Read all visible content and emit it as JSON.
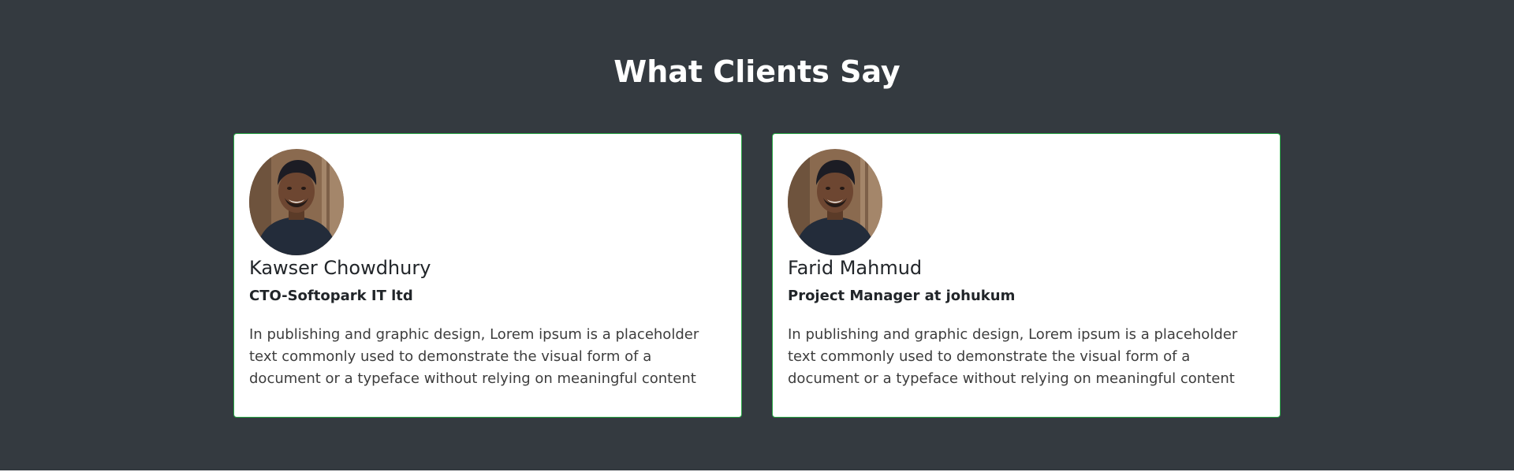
{
  "section": {
    "title": "What Clients Say"
  },
  "testimonials": [
    {
      "name": "Kawser Chowdhury",
      "role": "CTO-Softopark IT ltd",
      "quote": "In publishing and graphic design, Lorem ipsum is a placeholder text commonly used to demonstrate the visual form of a document or a typeface without relying on meaningful content",
      "avatar": "client-photo"
    },
    {
      "name": "Farid Mahmud",
      "role": "Project Manager at johukum",
      "quote": "In publishing and graphic design, Lorem ipsum is a placeholder text commonly used to demonstrate the visual form of a document or a typeface without relying on meaningful content",
      "avatar": "client-photo"
    }
  ],
  "colors": {
    "section_background": "#343a40",
    "card_border": "#28a745",
    "card_background": "#ffffff",
    "title_text": "#ffffff"
  }
}
